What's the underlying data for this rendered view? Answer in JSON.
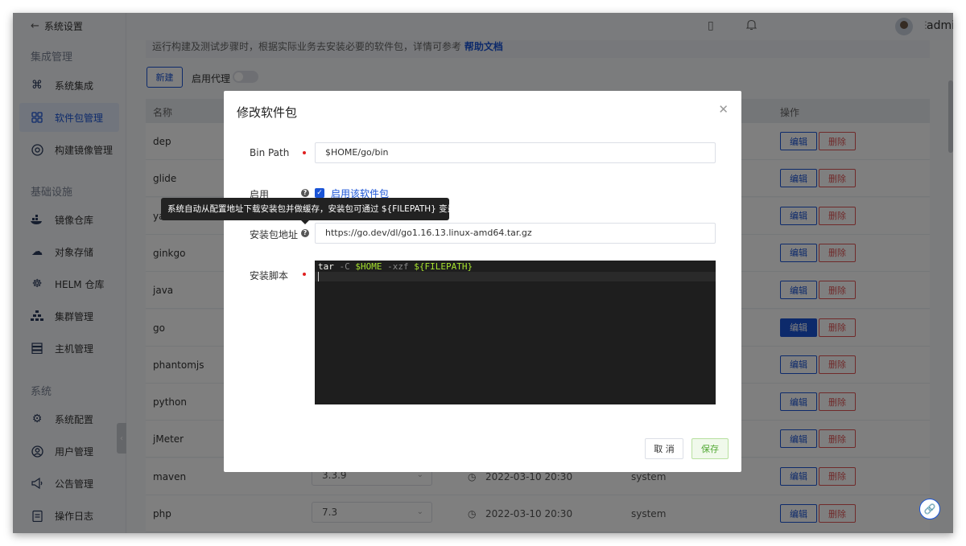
{
  "sidebar": {
    "back_label": "系统设置",
    "groups": [
      {
        "title": "集成管理"
      },
      {
        "title": "基础设施"
      },
      {
        "title": "系统"
      }
    ],
    "items": [
      {
        "label": "系统集成",
        "icon": "command-icon",
        "active": false
      },
      {
        "label": "软件包管理",
        "icon": "package-icon",
        "active": true
      },
      {
        "label": "构建镜像管理",
        "icon": "image-icon",
        "active": false
      },
      {
        "label": "镜像仓库",
        "icon": "docker-icon",
        "active": false
      },
      {
        "label": "对象存储",
        "icon": "cloud-icon",
        "active": false
      },
      {
        "label": "HELM 仓库",
        "icon": "helm-icon",
        "active": false
      },
      {
        "label": "集群管理",
        "icon": "cluster-icon",
        "active": false
      },
      {
        "label": "主机管理",
        "icon": "server-icon",
        "active": false
      },
      {
        "label": "系统配置",
        "icon": "gear-icon",
        "active": false
      },
      {
        "label": "用户管理",
        "icon": "user-icon",
        "active": false
      },
      {
        "label": "公告管理",
        "icon": "megaphone-icon",
        "active": false
      },
      {
        "label": "操作日志",
        "icon": "log-icon",
        "active": false
      }
    ]
  },
  "topbar": {
    "username": "admin(admin)"
  },
  "main": {
    "notice_text": "运行构建及测试步骤时，根据实际业务去安装必要的软件包，详情可参考",
    "notice_link": "帮助文档",
    "new_button": "新建",
    "proxy_label": "启用代理",
    "columns": {
      "name": "名称",
      "actions": "操作"
    },
    "rows": [
      {
        "name": "dep",
        "version": "",
        "time": "",
        "owner": ""
      },
      {
        "name": "glide",
        "version": "",
        "time": "",
        "owner": ""
      },
      {
        "name": "ya",
        "version": "",
        "time": "",
        "owner": ""
      },
      {
        "name": "ginkgo",
        "version": "",
        "time": "",
        "owner": ""
      },
      {
        "name": "java",
        "version": "",
        "time": "",
        "owner": ""
      },
      {
        "name": "go",
        "version": "",
        "time": "",
        "owner": "",
        "edit_hover": true
      },
      {
        "name": "phantomjs",
        "version": "",
        "time": "",
        "owner": ""
      },
      {
        "name": "python",
        "version": "",
        "time": "",
        "owner": ""
      },
      {
        "name": "jMeter",
        "version": "",
        "time": "",
        "owner": ""
      },
      {
        "name": "maven",
        "version": "3.3.9",
        "time": "2022-03-10 20:30",
        "owner": "system"
      },
      {
        "name": "php",
        "version": "7.3",
        "time": "2022-03-10 20:30",
        "owner": "system"
      }
    ],
    "edit_label": "编辑",
    "delete_label": "删除"
  },
  "modal": {
    "title": "修改软件包",
    "bin_path_label": "Bin Path",
    "bin_path_value": "$HOME/go/bin",
    "enable_label": "启用",
    "enable_checkbox_label": "启用该软件包",
    "enabled": true,
    "tooltip": "系统自动从配置地址下载安装包并做缓存，安装包可通过 ${FILEPATH} 变量获取",
    "download_url_label": "安装包地址",
    "download_url_value": "https://go.dev/dl/go1.16.13.linux-amd64.tar.gz",
    "script_label": "安装脚本",
    "script": {
      "cmd": "tar",
      "flag1": "-C",
      "var1": "$HOME",
      "flag2": "-xzf",
      "var2": "${FILEPATH}"
    },
    "cancel_label": "取 消",
    "save_label": "保存"
  },
  "colors": {
    "accent": "#1a54d6",
    "danger": "#e05555",
    "success": "#52a935"
  }
}
